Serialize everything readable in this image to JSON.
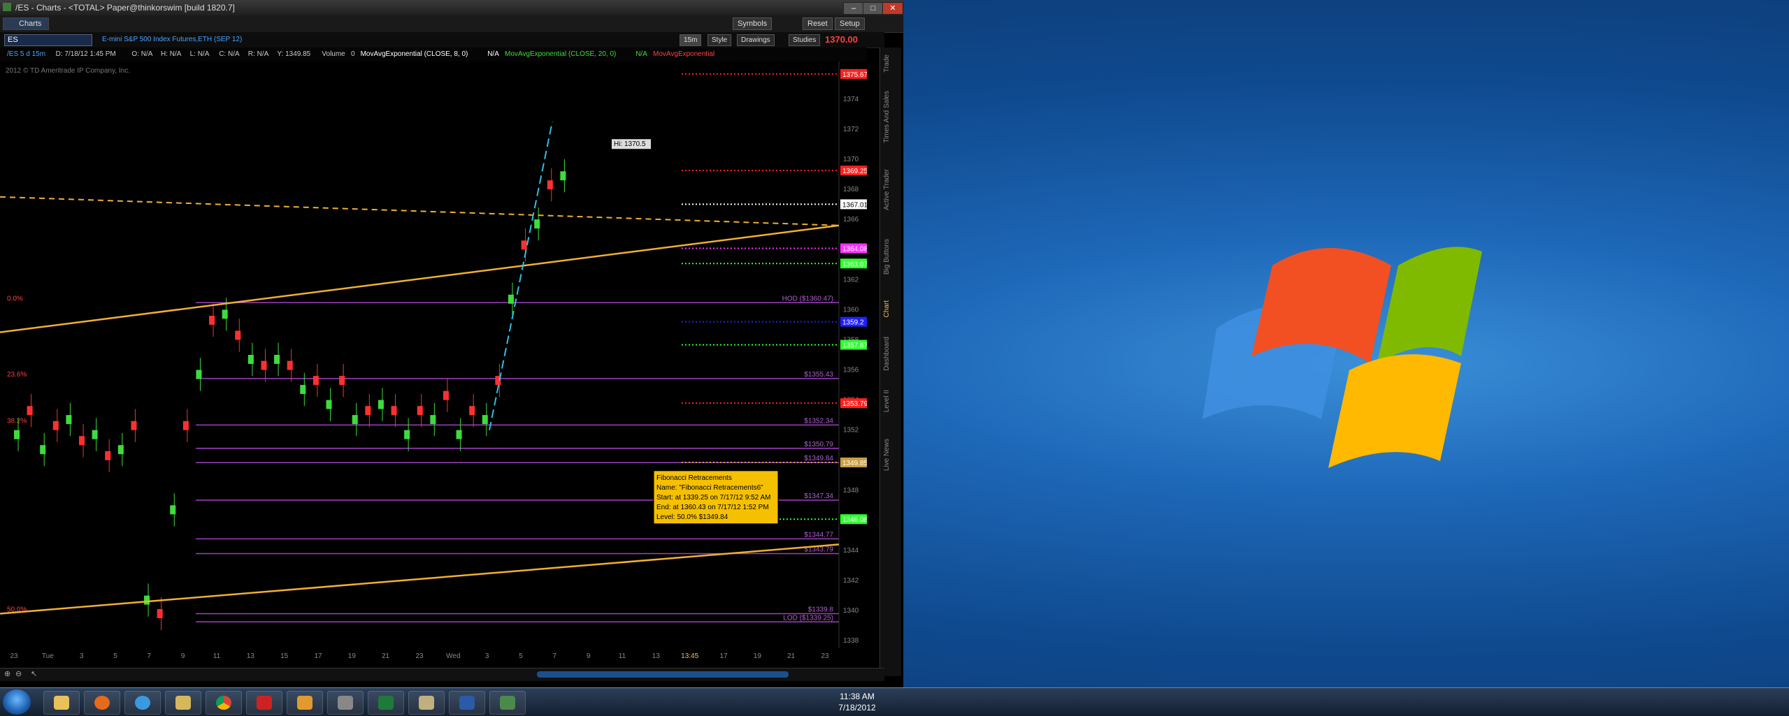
{
  "window": {
    "title": "/ES - Charts - <TOTAL> Paper@thinkorswim [build 1820.7]",
    "tab_label": "Charts",
    "buttons": [
      "Symbols",
      "Reset",
      "Setup"
    ]
  },
  "chart_header": {
    "symbol": "ES",
    "description": "E-mini S&P 500 Index Futures,ETH (SEP 12)",
    "timeframe": "15m",
    "tools": [
      "Style",
      "Drawings",
      "Studies"
    ],
    "last_price": "1370.00"
  },
  "study_row": {
    "items": [
      {
        "text": "/ES 5 d 15m",
        "color": "#4aa3ff"
      },
      {
        "text": "D: 7/18/12 1:45 PM",
        "color": "#cccccc"
      },
      {
        "text": "O: N/A",
        "color": "#cccccc"
      },
      {
        "text": "H: N/A",
        "color": "#cccccc"
      },
      {
        "text": "L: N/A",
        "color": "#cccccc"
      },
      {
        "text": "C: N/A",
        "color": "#cccccc"
      },
      {
        "text": "R: N/A",
        "color": "#cccccc"
      },
      {
        "text": "Y: 1349.85",
        "color": "#cccccc"
      },
      {
        "text": "Volume",
        "color": "#cccccc"
      },
      {
        "text": "0",
        "color": "#cccccc"
      },
      {
        "text": "MovAvgExponential (CLOSE, 8, 0)",
        "color": "#ffffff"
      },
      {
        "text": "N/A",
        "color": "#ffffff"
      },
      {
        "text": "MovAvgExponential (CLOSE, 20, 0)",
        "color": "#3ddc3d"
      },
      {
        "text": "N/A",
        "color": "#3ddc3d"
      },
      {
        "text": "MovAvgExponential",
        "color": "#ff4040"
      }
    ]
  },
  "copyright": "2012 © TD Ameritrade IP Company, Inc.",
  "chart_data": {
    "type": "candlestick",
    "y_ticks": [
      1338,
      1340,
      1342,
      1344,
      1346,
      1348,
      1350,
      1352,
      1354,
      1356,
      1358,
      1360,
      1362,
      1364,
      1366,
      1368,
      1370,
      1372,
      1374
    ],
    "ylim": [
      1337.5,
      1376.5
    ],
    "x_ticks": [
      "23",
      "Tue",
      "3",
      "5",
      "7",
      "9",
      "11",
      "13",
      "15",
      "17",
      "19",
      "21",
      "23",
      "Wed",
      "3",
      "5",
      "7",
      "9",
      "11",
      "13",
      "13:45",
      "17",
      "19",
      "21",
      "23"
    ],
    "price_labels": [
      {
        "value": "1375.67",
        "y": 1375.67,
        "bg": "#ff2020"
      },
      {
        "value": "1369.25",
        "y": 1369.25,
        "bg": "#ff2020"
      },
      {
        "value": "1367.01",
        "y": 1367.01,
        "bg": "#ffffff"
      },
      {
        "value": "1364.08",
        "y": 1364.08,
        "bg": "#ff30ff"
      },
      {
        "value": "1363.07",
        "y": 1363.07,
        "bg": "#30ff30"
      },
      {
        "value": "1359.2",
        "y": 1359.2,
        "bg": "#2020ff"
      },
      {
        "value": "1357.67",
        "y": 1357.67,
        "bg": "#30ff30"
      },
      {
        "value": "1353.79",
        "y": 1353.79,
        "bg": "#ff2020"
      },
      {
        "value": "1349.85",
        "y": 1349.85,
        "bg": "#c8a040"
      },
      {
        "value": "1346.08",
        "y": 1346.08,
        "bg": "#30ff30"
      }
    ],
    "fib_levels": [
      {
        "label": "0.0%",
        "y": 1360.47,
        "right": "HOD ($1360.47)"
      },
      {
        "label": "23.6%",
        "y": 1355.43,
        "right": "$1355.43"
      },
      {
        "label": "38.2%",
        "y": 1352.34,
        "right": "$1352.34"
      },
      {
        "label": "",
        "y": 1350.79,
        "right": "$1350.79"
      },
      {
        "label": "",
        "y": 1349.84,
        "right": "$1349.84"
      },
      {
        "label": "",
        "y": 1347.34,
        "right": "$1347.34"
      },
      {
        "label": "",
        "y": 1344.77,
        "right": "$1344.77"
      },
      {
        "label": "",
        "y": 1343.79,
        "right": "$1343.79"
      },
      {
        "label": "50.0%",
        "y": 1339.8,
        "right": "$1339.8"
      },
      {
        "label": "",
        "y": 1339.25,
        "right": "LOD ($1339.25)"
      }
    ],
    "hi_label": "Hi: 1370.5",
    "tooltip": [
      "Fibonacci Retracements",
      "Name: \"Fibonacci Retracements6\"",
      "Start: at 1339.25 on 7/17/12 9:52 AM",
      "End: at 1360.43 on 7/17/12 1:52 PM",
      "Level: 50.0% $1349.84"
    ]
  },
  "sidebar_tabs": [
    "Trade",
    "Times And Sales",
    "Active Trader",
    "Big Buttons",
    "Chart",
    "Dashboard",
    "Level II",
    "Live News"
  ],
  "taskbar": {
    "time": "11:38 AM",
    "date": "7/18/2012"
  }
}
